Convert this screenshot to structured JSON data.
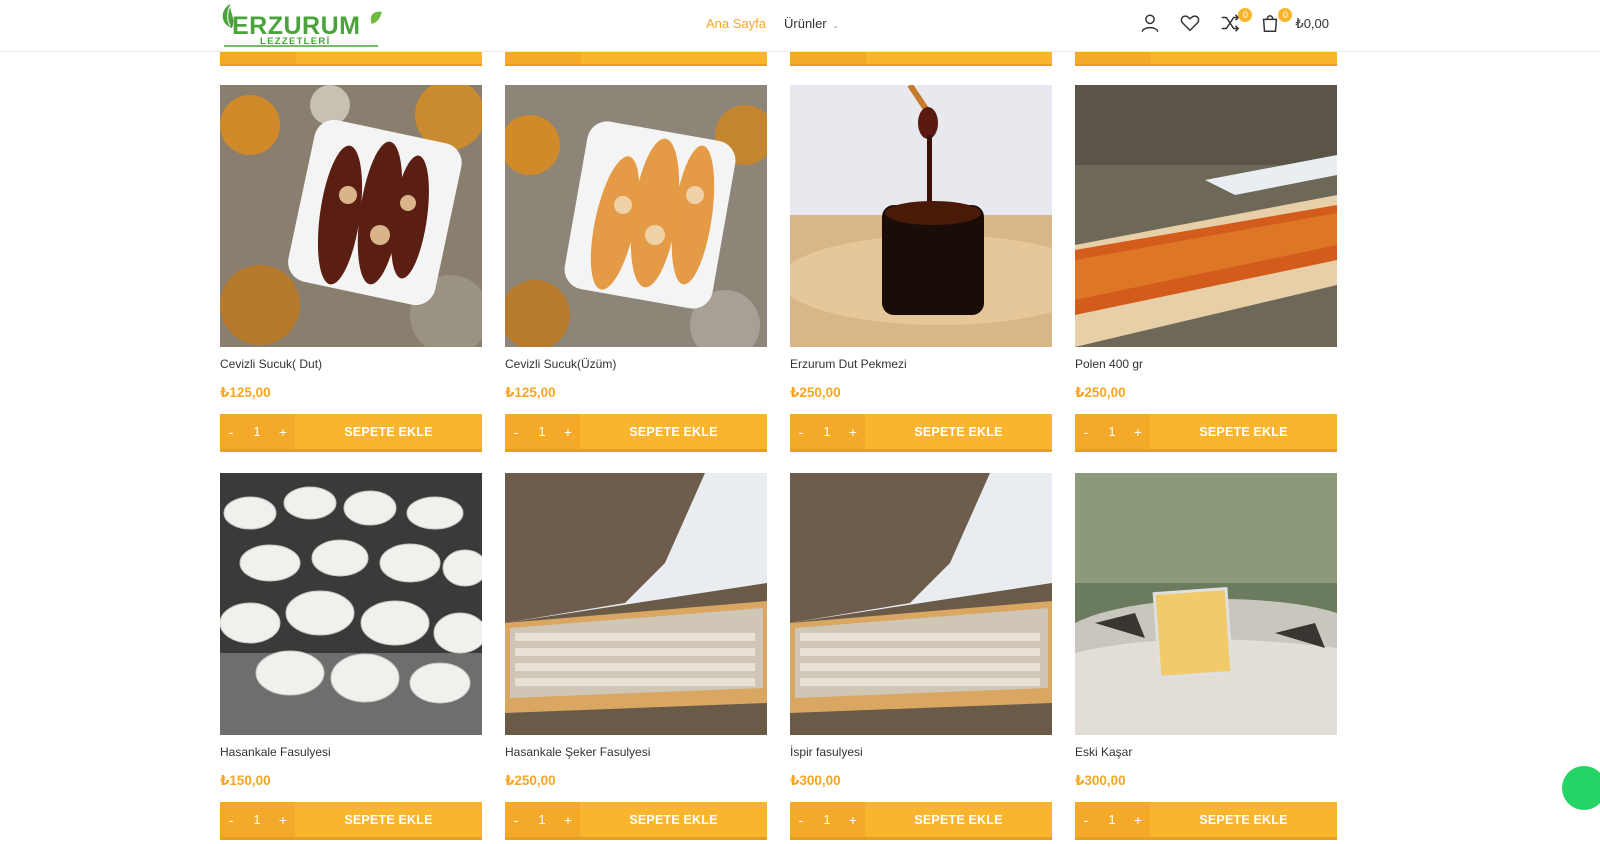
{
  "header": {
    "logo_text": "ERZURUM",
    "logo_sub": "LEZZETLERİ",
    "nav": [
      {
        "label": "Ana Sayfa",
        "active": true
      },
      {
        "label": "Ürünler",
        "active": false
      }
    ],
    "compare_count": "0",
    "cart_count": "0",
    "cart_total": "₺0,00",
    "icons": [
      "user-icon",
      "heart-icon",
      "compare-icon",
      "cart-icon"
    ]
  },
  "colors": {
    "accent": "#f9b52e",
    "price": "#f6a623",
    "logo_green": "#4aa33b"
  },
  "products": [
    {
      "name": "Cevizli Sucuk( Dut)",
      "price": "₺125,00",
      "qty": "1",
      "button": "SEPETE EKLE",
      "image": "dark walnut sucuk on white tray"
    },
    {
      "name": "Cevizli Sucuk(Üzüm)",
      "price": "₺125,00",
      "qty": "1",
      "button": "SEPETE EKLE",
      "image": "golden walnut sucuk on white tray"
    },
    {
      "name": "Erzurum Dut Pekmezi",
      "price": "₺250,00",
      "qty": "1",
      "button": "SEPETE EKLE",
      "image": "molasses jar with dipper"
    },
    {
      "name": "Polen 400 gr",
      "price": "₺250,00",
      "qty": "1",
      "button": "SEPETE EKLE",
      "image": "pollen on wooden board"
    },
    {
      "name": "Hasankale Fasulyesi",
      "price": "₺150,00",
      "qty": "1",
      "button": "SEPETE EKLE",
      "image": "white beans"
    },
    {
      "name": "Hasankale Şeker Fasulyesi",
      "price": "₺250,00",
      "qty": "1",
      "button": "SEPETE EKLE",
      "image": "small beans on wooden board"
    },
    {
      "name": "İspir fasulyesi",
      "price": "₺300,00",
      "qty": "1",
      "button": "SEPETE EKLE",
      "image": "small beans on wooden board"
    },
    {
      "name": "Eski Kaşar",
      "price": "₺300,00",
      "qty": "1",
      "button": "SEPETE EKLE",
      "image": "aged cheese on rock"
    }
  ],
  "qty_minus": "-",
  "qty_plus": "+"
}
